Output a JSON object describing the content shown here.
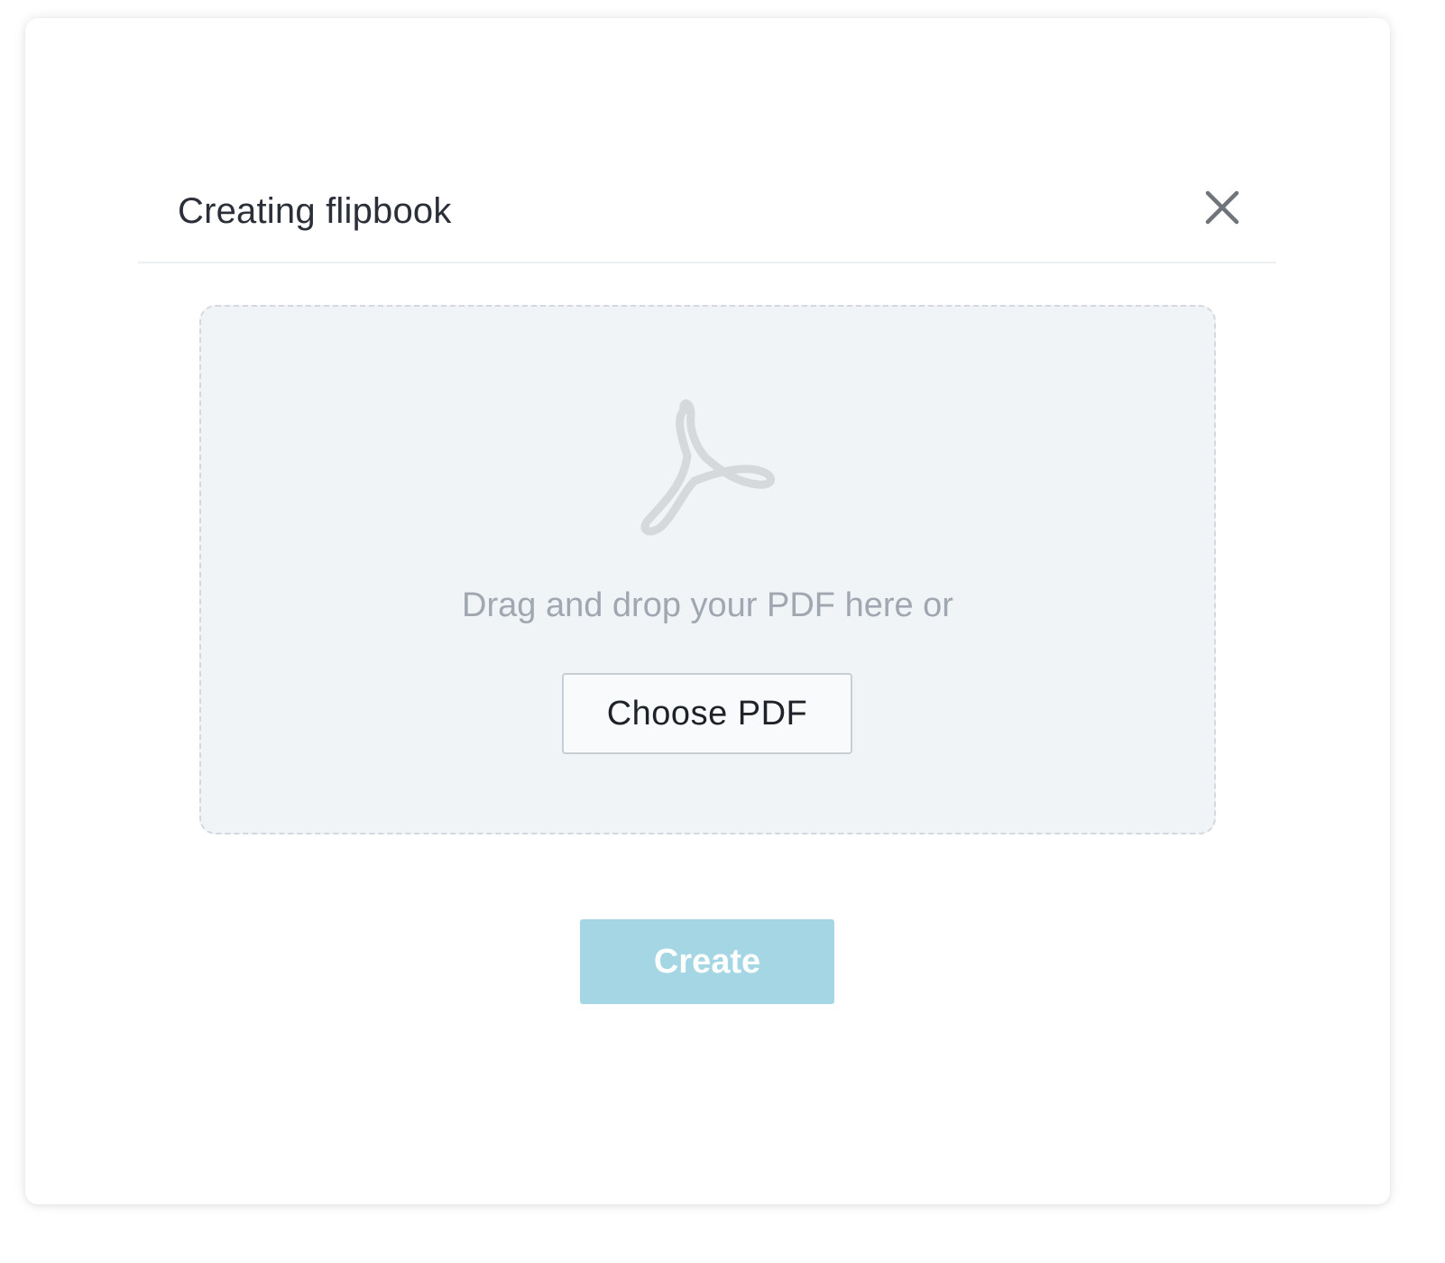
{
  "dialog": {
    "title": "Creating flipbook",
    "close_icon": "close-icon"
  },
  "dropzone": {
    "icon": "pdf-icon",
    "instruction": "Drag and drop your PDF here or",
    "choose_label": "Choose PDF"
  },
  "footer": {
    "create_label": "Create"
  },
  "colors": {
    "accent_disabled": "#a4d6e3",
    "dropzone_bg": "#f1f4f7",
    "icon_gray": "#d5d9dc"
  }
}
